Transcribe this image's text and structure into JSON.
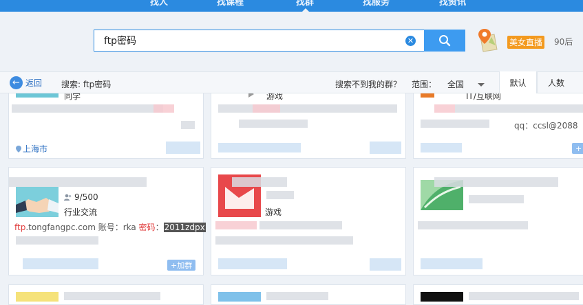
{
  "topnav": {
    "tabs": [
      "找人",
      "找课程",
      "找群",
      "找服务",
      "找资讯"
    ]
  },
  "search": {
    "query": "ftp密码",
    "clear_icon": "clear-icon",
    "button_icon": "search-icon"
  },
  "promo": {
    "live_badge": "美女直播",
    "tag": "90后"
  },
  "toolbar": {
    "back_label": "返回",
    "search_label": "搜索: ftp密码",
    "no_group_link": "搜索不到我的群？",
    "range_label": "范围：",
    "range_value": "全国",
    "sort_default": "默认",
    "sort_members": "人数"
  },
  "cards": {
    "row1": {
      "c1_category": "同学",
      "c1_location": "上海市",
      "c2_category": "游戏",
      "c3_category": "IT/互联网",
      "c3_desc": "qq：ccsl@2088"
    },
    "row2": {
      "c1_members": "9/500",
      "c1_category": "行业交流",
      "c1_desc_prefix": "ftp",
      "c1_desc_domain": ".tongfangpc.com 账号：rka ",
      "c1_desc_pw_label": "密码",
      "c1_desc_colon": "：",
      "c1_desc_pw": "2011zdpx",
      "c1_join": "+加群",
      "c2_category": "游戏"
    }
  },
  "colors": {
    "accent": "#2b8ae0",
    "live_badge": "#f39a1f",
    "highlight_red": "#e03b3b"
  }
}
